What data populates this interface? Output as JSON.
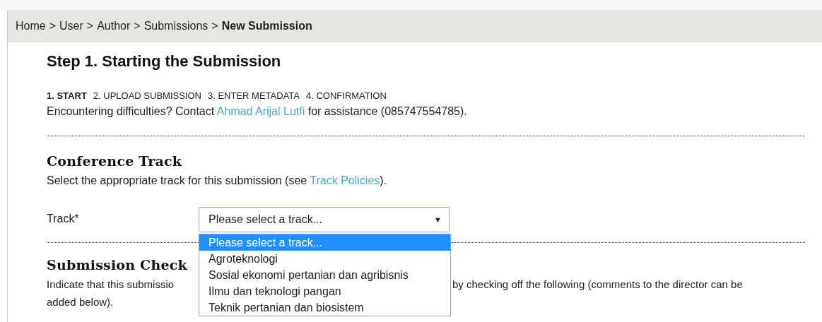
{
  "breadcrumb": [
    {
      "label": "Home",
      "current": false
    },
    {
      "label": "User",
      "current": false
    },
    {
      "label": "Author",
      "current": false
    },
    {
      "label": "Submissions",
      "current": false
    },
    {
      "label": "New Submission",
      "current": true
    }
  ],
  "breadcrumb_separator": ">",
  "title": "Step 1. Starting the Submission",
  "steps": [
    {
      "label": "1. START",
      "current": true
    },
    {
      "label": "2. UPLOAD SUBMISSION",
      "current": false
    },
    {
      "label": "3. ENTER METADATA",
      "current": false
    },
    {
      "label": "4. CONFIRMATION",
      "current": false
    }
  ],
  "help": {
    "before": "Encountering difficulties? Contact",
    "link": "Ahmad Arijal Lutfi",
    "after": "for assistance (085747554785)."
  },
  "track_section": {
    "heading": "Conference Track",
    "intro_before": "Select the appropriate track for this submission (see",
    "intro_link": "Track Policies",
    "intro_after": ").",
    "field_label": "Track*",
    "select_value": "Please select a track...",
    "caret": "▼",
    "options": [
      {
        "label": "Please select a track...",
        "selected": true
      },
      {
        "label": "Agroteknologi",
        "selected": false
      },
      {
        "label": "Sosial ekonomi pertanian dan agribisnis",
        "selected": false
      },
      {
        "label": "Ilmu dan teknologi pangan",
        "selected": false
      },
      {
        "label": "Teknik pertanian dan biosistem",
        "selected": false
      }
    ]
  },
  "checklist_section": {
    "heading": "Submission Check",
    "intro_visible_start": "Indicate that this submissio",
    "intro_visible_end": "by checking off the following (comments to the director can be",
    "intro_line_2": "added below)."
  }
}
